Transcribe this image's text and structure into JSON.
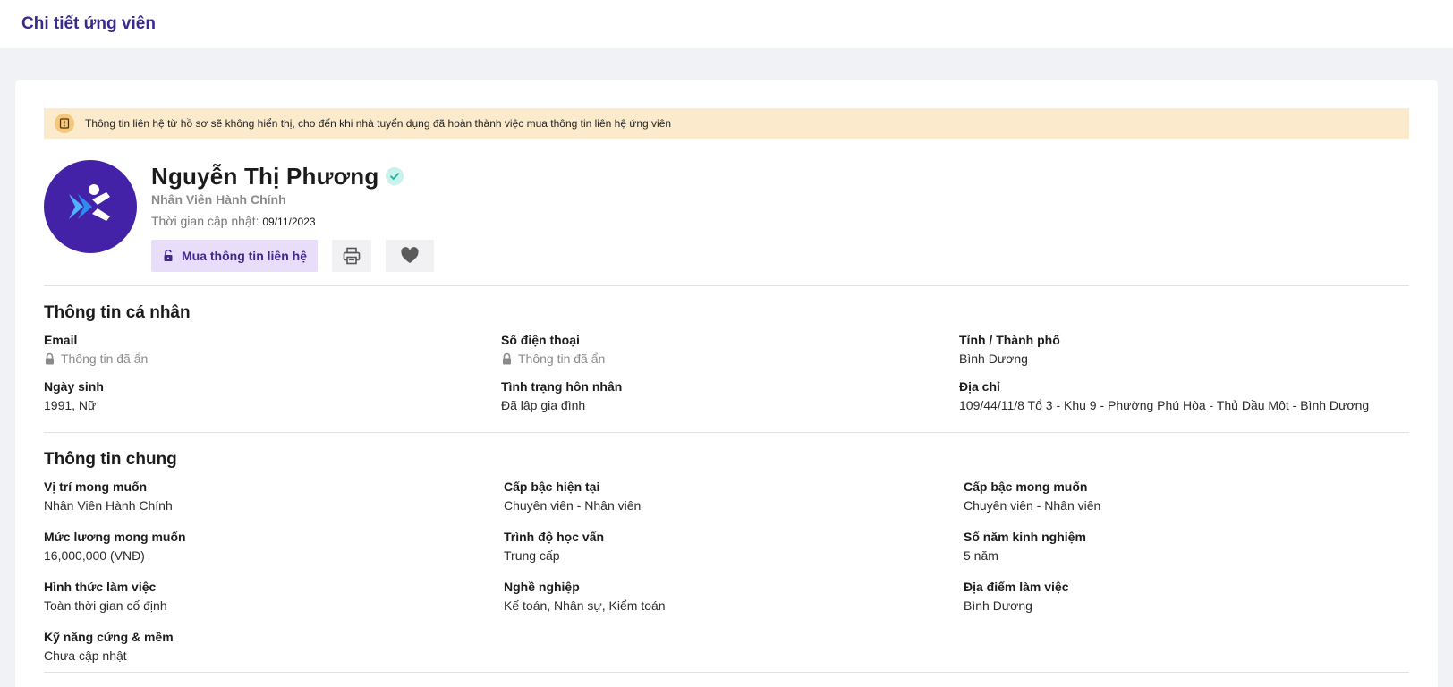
{
  "header": {
    "title": "Chi tiết ứng viên"
  },
  "notice": {
    "text": "Thông tin liên hệ từ hồ sơ sẽ không hiển thị, cho đến khi nhà tuyển dụng đã hoàn thành việc mua thông tin liên hệ ứng viên"
  },
  "candidate": {
    "name": "Nguyễn Thị Phương",
    "job_title": "Nhân Viên Hành Chính",
    "updated_label": "Thời gian cập nhật:",
    "updated_date": "09/11/2023"
  },
  "actions": {
    "buy_label": "Mua thông tin liên hệ"
  },
  "personal": {
    "title": "Thông tin cá nhân",
    "email_label": "Email",
    "email_value": "Thông tin đã ẩn",
    "phone_label": "Số điện thoại",
    "phone_value": "Thông tin đã ẩn",
    "city_label": "Tỉnh / Thành phố",
    "city_value": "Bình Dương",
    "dob_label": "Ngày sinh",
    "dob_value": "1991, Nữ",
    "marital_label": "Tình trạng hôn nhân",
    "marital_value": "Đã lập gia đình",
    "address_label": "Địa chỉ",
    "address_value": "109/44/11/8 Tổ 3 - Khu 9 - Phường Phú Hòa - Thủ Dầu Một - Bình Dương"
  },
  "general": {
    "title": "Thông tin chung",
    "fields": [
      {
        "label": "Vị trí mong muốn",
        "value": "Nhân Viên Hành Chính"
      },
      {
        "label": "Cấp bậc hiện tại",
        "value": "Chuyên viên - Nhân viên"
      },
      {
        "label": "Cấp bậc mong muốn",
        "value": "Chuyên viên - Nhân viên"
      },
      {
        "label": "Mức lương mong muốn",
        "value": "16,000,000 (VNĐ)"
      },
      {
        "label": "Trình độ học vấn",
        "value": "Trung cấp"
      },
      {
        "label": "Số năm kinh nghiệm",
        "value": "5 năm"
      },
      {
        "label": "Hình thức làm việc",
        "value": "Toàn thời gian cố định"
      },
      {
        "label": "Nghề nghiệp",
        "value": "Kế toán, Nhân sự, Kiểm toán"
      },
      {
        "label": "Địa điểm làm việc",
        "value": "Bình Dương"
      },
      {
        "label": "Kỹ năng cứng & mềm",
        "value": "Chưa cập nhật"
      }
    ]
  },
  "colors": {
    "brand": "#3b2a8c",
    "avatar_bg": "#4322a8",
    "notice_bg": "#fbeacc",
    "buy_button_bg": "#e8def9"
  }
}
